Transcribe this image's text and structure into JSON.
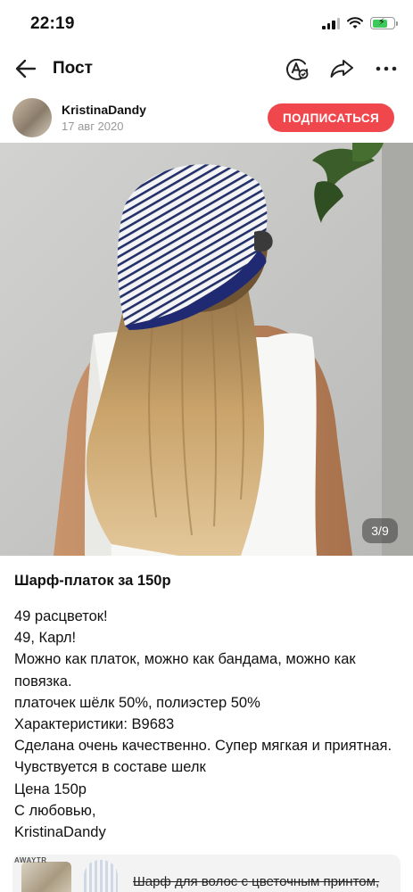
{
  "status_bar": {
    "time": "22:19"
  },
  "nav": {
    "title": "Пост",
    "icons": [
      "back-arrow-icon",
      "translate-icon",
      "share-icon",
      "more-icon"
    ]
  },
  "author": {
    "name": "KristinaDandy",
    "date": "17 авг 2020",
    "subscribe_label": "ПОДПИСАТЬСЯ"
  },
  "photo": {
    "counter": "3/9",
    "subject": "woman wearing striped silk scarf"
  },
  "post": {
    "title": "Шарф-платок за 150р",
    "lines": [
      "49 расцветок!",
      "49, Карл!",
      "Можно как платок, можно как бандама, можно как повязка.",
      "платочек шёлк 50%, полиэстер 50%",
      "Характеристики: B9683",
      "Сделана очень качественно. Супер мягкая и приятная. Чувствуется в составе шелк",
      "Цена 150р",
      "С любовью,",
      "KristinaDandy"
    ]
  },
  "related": {
    "brand": "AWAYTR",
    "text": "Шарф для волос с цветочным принтом,"
  },
  "colors": {
    "accent": "#f0474d",
    "battery": "#3dc95b",
    "text": "#111111",
    "muted": "#999999"
  }
}
